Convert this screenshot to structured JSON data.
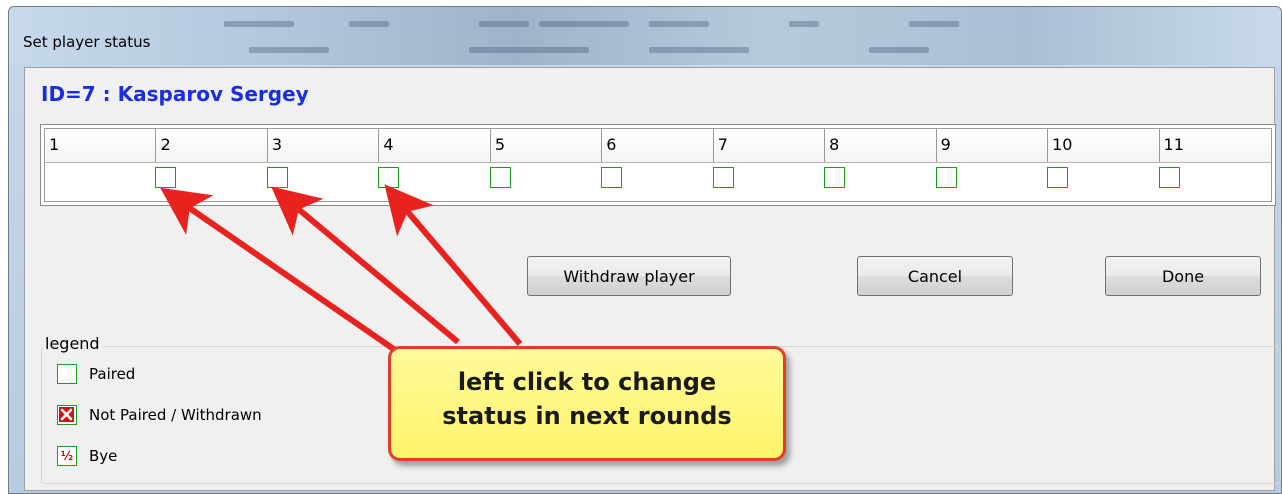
{
  "window": {
    "title": "Set player status"
  },
  "player": {
    "heading": "ID=7 : Kasparov Sergey"
  },
  "rounds": [
    "1",
    "2",
    "3",
    "4",
    "5",
    "6",
    "7",
    "8",
    "9",
    "10",
    "11"
  ],
  "round_status": [
    "none",
    "paired",
    "paired",
    "paired",
    "paired",
    "paired",
    "paired",
    "paired",
    "paired",
    "paired",
    "paired"
  ],
  "buttons": {
    "withdraw": "Withdraw player",
    "cancel": "Cancel",
    "done": "Done"
  },
  "legend": {
    "title": "legend",
    "items": [
      {
        "label": "Paired",
        "icon": "paired-box-icon"
      },
      {
        "label": "Not Paired / Withdrawn",
        "icon": "red-x-icon"
      },
      {
        "label": "Bye",
        "icon": "half-point-icon",
        "glyph": "½"
      }
    ]
  },
  "callout": {
    "line1": "left click to change",
    "line2": "status in next rounds"
  },
  "colors": {
    "player_heading": "#1b2de0",
    "checkbox_border": "#1c9e1c",
    "arrow": "#e8231f",
    "callout_fill": "#fff36a",
    "callout_border": "#e53b2a"
  }
}
